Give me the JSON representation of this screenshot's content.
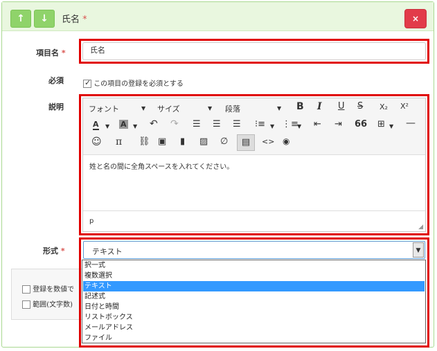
{
  "header": {
    "up_icon": "↑",
    "down_icon": "↓",
    "title": "氏名",
    "required_mark": "*",
    "delete_icon": "×"
  },
  "fields": {
    "item_name": {
      "label": "項目名",
      "required_mark": "*",
      "value": "氏名"
    },
    "required": {
      "label": "必須",
      "checkbox_label": "この項目の登録を必須とする",
      "checked": true
    },
    "description": {
      "label": "説明"
    },
    "format": {
      "label": "形式",
      "required_mark": "*",
      "selected": "テキスト"
    }
  },
  "editor": {
    "font_label": "フォント",
    "size_label": "サイズ",
    "paragraph_label": "段落",
    "bold": "B",
    "italic": "I",
    "underline": "U",
    "strike": "S",
    "subscript": "X₂",
    "superscript": "X²",
    "text_color": "A",
    "bg_color": "A",
    "undo": "↶",
    "redo": "↷",
    "quote": "66",
    "hr": "—",
    "emoji": "☺",
    "pi": "π",
    "source": "<>",
    "preview": "◉",
    "content": "姓と名の間に全角スペースを入れてください。",
    "status_path": "p"
  },
  "format_options": [
    "択一式",
    "複数選択",
    "テキスト",
    "記述式",
    "日付と時間",
    "リストボックス",
    "メールアドレス",
    "ファイル"
  ],
  "sub_options": [
    {
      "label": "登録を数値で",
      "checked": false
    },
    {
      "label": "範囲(文字数)",
      "checked": false
    }
  ],
  "colors": {
    "header_bg": "#e9f7df",
    "arrow_btn": "#8fd36a",
    "delete_btn": "#e23b4a",
    "highlight": "#e00000",
    "selected_option": "#3399ff"
  }
}
